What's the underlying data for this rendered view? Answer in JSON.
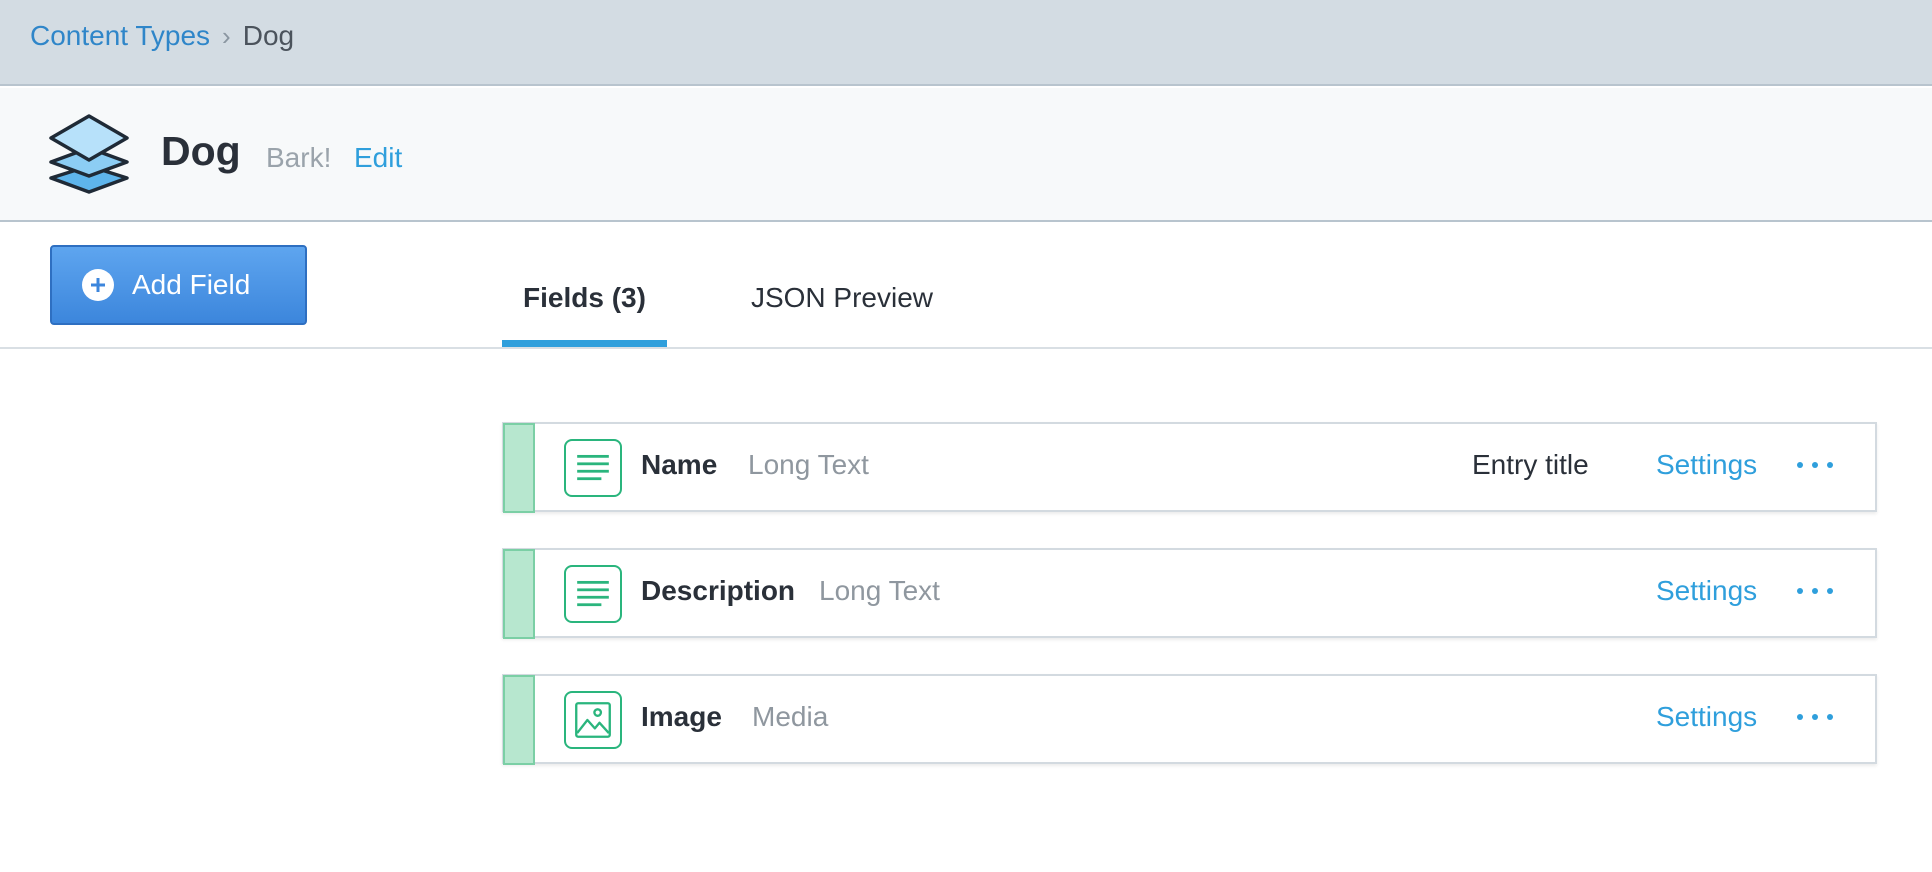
{
  "breadcrumb": {
    "parent": "Content Types",
    "separator": "›",
    "current": "Dog"
  },
  "entity": {
    "icon": "layers-icon",
    "title": "Dog",
    "description": "Bark!",
    "edit_label": "Edit"
  },
  "toolbar": {
    "add_field_label": "Add Field"
  },
  "tabs": [
    {
      "label": "Fields (3)",
      "active": true
    },
    {
      "label": "JSON Preview",
      "active": false
    }
  ],
  "fields": [
    {
      "name": "Name",
      "type": "Long Text",
      "icon": "long-text-icon",
      "entry_title": "Entry title",
      "settings_label": "Settings"
    },
    {
      "name": "Description",
      "type": "Long Text",
      "icon": "long-text-icon",
      "entry_title": "",
      "settings_label": "Settings"
    },
    {
      "name": "Image",
      "type": "Media",
      "icon": "media-icon",
      "entry_title": "",
      "settings_label": "Settings"
    }
  ],
  "colors": {
    "accent": "#2f9fdc",
    "button": "#4a90e2",
    "field_green": "#2ab57d",
    "handle_green": "#b7e7cf"
  }
}
